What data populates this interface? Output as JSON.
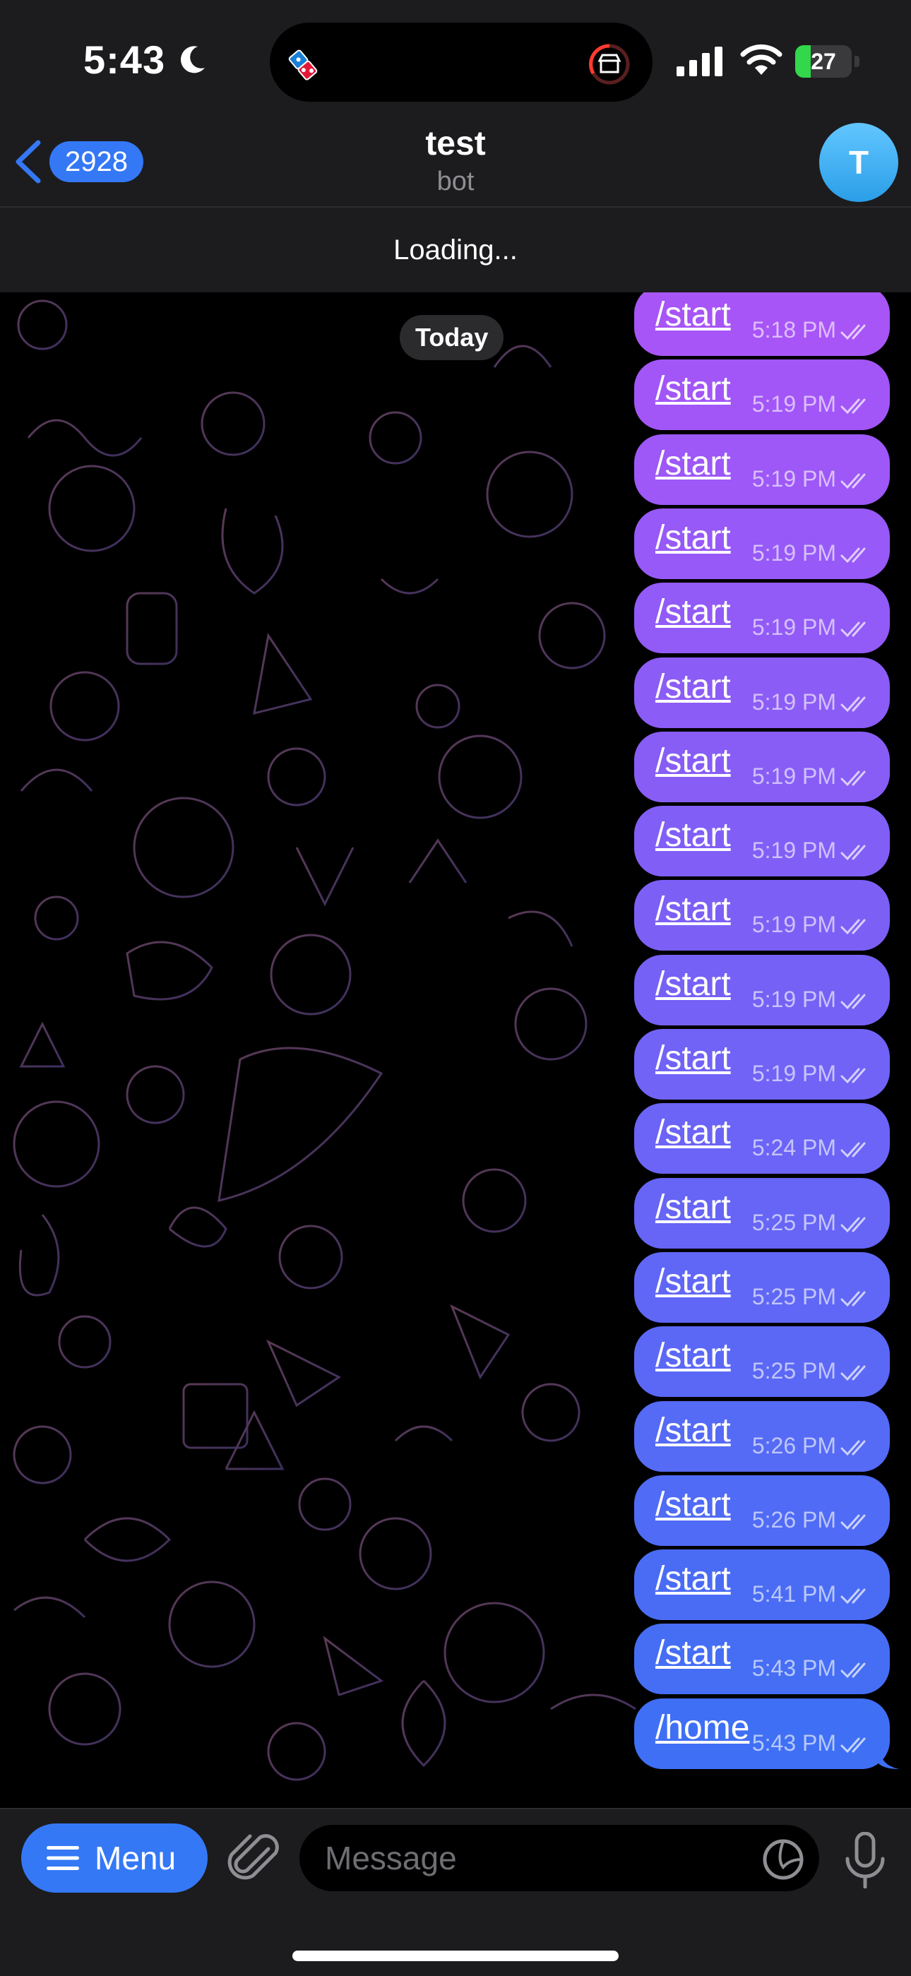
{
  "status_bar": {
    "time": "5:43",
    "battery": "27",
    "battery_level": 0.27,
    "icons": [
      "moon-icon",
      "dominos-icon",
      "store-icon",
      "signal-icon",
      "wifi-icon",
      "battery-icon"
    ]
  },
  "header": {
    "back_count": "2928",
    "title": "test",
    "subtitle": "bot",
    "avatar_letter": "T"
  },
  "loading": {
    "text": "Loading..."
  },
  "chat": {
    "date_label": "Today",
    "messages": [
      {
        "text": "/start",
        "time": "5:18 PM"
      },
      {
        "text": "/start",
        "time": "5:19 PM"
      },
      {
        "text": "/start",
        "time": "5:19 PM"
      },
      {
        "text": "/start",
        "time": "5:19 PM"
      },
      {
        "text": "/start",
        "time": "5:19 PM"
      },
      {
        "text": "/start",
        "time": "5:19 PM"
      },
      {
        "text": "/start",
        "time": "5:19 PM"
      },
      {
        "text": "/start",
        "time": "5:19 PM"
      },
      {
        "text": "/start",
        "time": "5:19 PM"
      },
      {
        "text": "/start",
        "time": "5:19 PM"
      },
      {
        "text": "/start",
        "time": "5:19 PM"
      },
      {
        "text": "/start",
        "time": "5:24 PM"
      },
      {
        "text": "/start",
        "time": "5:25 PM"
      },
      {
        "text": "/start",
        "time": "5:25 PM"
      },
      {
        "text": "/start",
        "time": "5:25 PM"
      },
      {
        "text": "/start",
        "time": "5:26 PM"
      },
      {
        "text": "/start",
        "time": "5:26 PM"
      },
      {
        "text": "/start",
        "time": "5:41 PM"
      },
      {
        "text": "/start",
        "time": "5:43 PM"
      },
      {
        "text": "/home",
        "time": "5:43 PM"
      }
    ]
  },
  "input_bar": {
    "menu_label": "Menu",
    "placeholder": "Message"
  },
  "colors": {
    "accent": "#3478f6",
    "bubble_top": "#a855f7",
    "bubble_bottom": "#3f6ff5",
    "header_bg": "#1c1c1e"
  }
}
